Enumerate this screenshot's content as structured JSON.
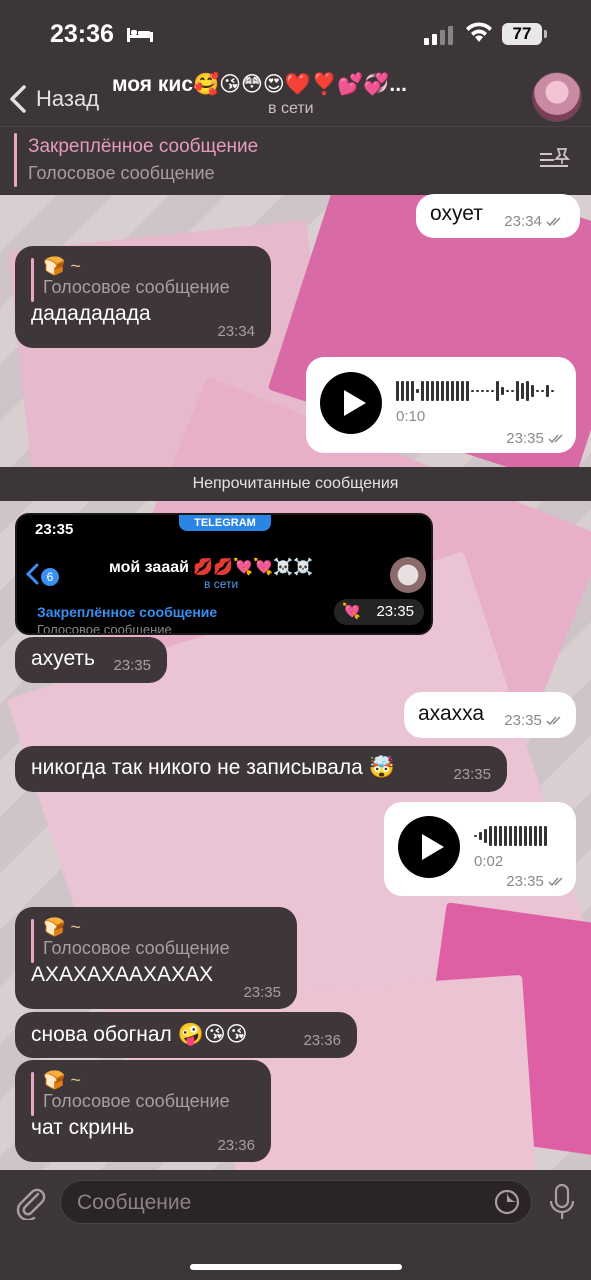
{
  "status_bar": {
    "time": "23:36",
    "battery": "77"
  },
  "header": {
    "back_label": "Назад",
    "title": "моя кис🥰😘😳😍❤️❣️💕💞...",
    "status": "в сети"
  },
  "pinned": {
    "title": "Закреплённое сообщение",
    "subtitle": "Голосовое сообщение"
  },
  "unread_label": "Непрочитанные сообщения",
  "messages": [
    {
      "dir": "out",
      "text": "охует",
      "time": "23:34"
    },
    {
      "dir": "in",
      "reply_emoji": "🍞 ~",
      "reply_sub": "Голосовое сообщение",
      "text": "дадададада",
      "time": "23:34"
    },
    {
      "dir": "out",
      "voice_duration": "0:10",
      "time": "23:35"
    },
    {
      "dir": "in",
      "text": "ахуеть",
      "time": "23:35"
    },
    {
      "dir": "out",
      "text": "ахахха",
      "time": "23:35"
    },
    {
      "dir": "in",
      "text": "никогда так никого не записывала 🤯",
      "time": "23:35"
    },
    {
      "dir": "out",
      "voice_duration": "0:02",
      "time": "23:35"
    },
    {
      "dir": "in",
      "reply_emoji": "🍞 ~",
      "reply_sub": "Голосовое сообщение",
      "text": "АХАХАХААХАХАХ",
      "time": "23:35"
    },
    {
      "dir": "in",
      "text": "снова обогнал 🤪😘😘",
      "time": "23:36"
    },
    {
      "dir": "in",
      "reply_emoji": "🍞 ~",
      "reply_sub": "Голосовое сообщение",
      "text": "чат скринь",
      "time": "23:36"
    }
  ],
  "embedded_screenshot": {
    "time": "23:35",
    "badge": "TELEGRAM",
    "back_count": "6",
    "title": "мой зааай 💋💋💘💘☠️☠️",
    "status": "в сети",
    "pinned_title": "Закреплённое сообщение",
    "pinned_sub": "Голосовое сообщение",
    "time_chip": "23:35",
    "heart": "💘"
  },
  "input": {
    "placeholder": "Сообщение"
  }
}
